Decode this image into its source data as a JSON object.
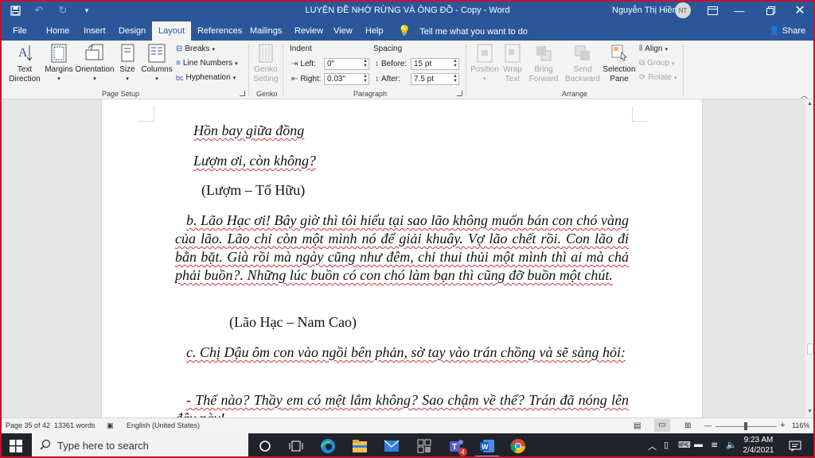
{
  "titlebar": {
    "document_title": "LUYỆN ĐỀ NHỚ RỪNG VÀ ÔNG ĐỒ - Copy  -  Word",
    "user_name": "Nguyễn Thị Hiền",
    "user_initials": "NT"
  },
  "tabs": [
    "File",
    "Home",
    "Insert",
    "Design",
    "Layout",
    "References",
    "Mailings",
    "Review",
    "View",
    "Help"
  ],
  "active_tab": "Layout",
  "tell_me": "Tell me what you want to do",
  "share": "Share",
  "ribbon": {
    "page_setup": {
      "text_direction": [
        "Text",
        "Direction"
      ],
      "margins": "Margins",
      "orientation": "Orientation",
      "size": "Size",
      "columns": "Columns",
      "breaks": "Breaks",
      "line_numbers": "Line Numbers",
      "hyphenation": "Hyphenation",
      "label": "Page Setup"
    },
    "genko": {
      "button": [
        "Genko",
        "Setting"
      ],
      "label": "Genko"
    },
    "paragraph": {
      "indent_title": "Indent",
      "spacing_title": "Spacing",
      "left_label": "Left:",
      "left_value": "0\"",
      "right_label": "Right:",
      "right_value": "0.03\"",
      "before_label": "Before:",
      "before_value": "15 pt",
      "after_label": "After:",
      "after_value": "7.5 pt",
      "label": "Paragraph"
    },
    "arrange": {
      "position": "Position",
      "wrap_text": [
        "Wrap",
        "Text"
      ],
      "bring_forward": [
        "Bring",
        "Forward"
      ],
      "send_backward": [
        "Send",
        "Backward"
      ],
      "selection_pane": [
        "Selection",
        "Pane"
      ],
      "align": "Align",
      "group": "Group",
      "rotate": "Rotate",
      "label": "Arrange"
    }
  },
  "document": {
    "line1": "Hồn bay giữa đồng",
    "line2": "Lượm ơi, còn không?",
    "line3": "(Lượm – Tố Hữu)",
    "para_b": "b. Lão Hạc ơi! Bây giờ thì tôi hiểu tại sao lão không muốn bán con chó vàng của lão. Lão chỉ còn một mình nó để giải khuây. Vợ lão chết rồi. Con lão đi bằn bặt. Già rồi mà ngày cũng như đêm, chỉ thui thủi một mình thì ai mà chả phải buồn?. Những lúc buồn có con chó làm bạn thì cũng đỡ buồn một chút.",
    "citation_b": "(Lão Hạc – Nam Cao)",
    "para_c": "c. Chị Dậu ôm con vào ngồi bên phản, sờ tay vào trán chồng và sẽ sàng hỏi:",
    "para_d": "- Thế nào? Thầy em có mệt lắm không? Sao chậm về thế? Trán đã nóng lên đây này!"
  },
  "statusbar": {
    "page": "Page 35 of 42",
    "words": "13361 words",
    "language": "English (United States)",
    "zoom": "116%"
  },
  "taskbar": {
    "search_placeholder": "Type here to search",
    "teams_badge": "4",
    "time": "9:23 AM",
    "date": "2/4/2021"
  }
}
